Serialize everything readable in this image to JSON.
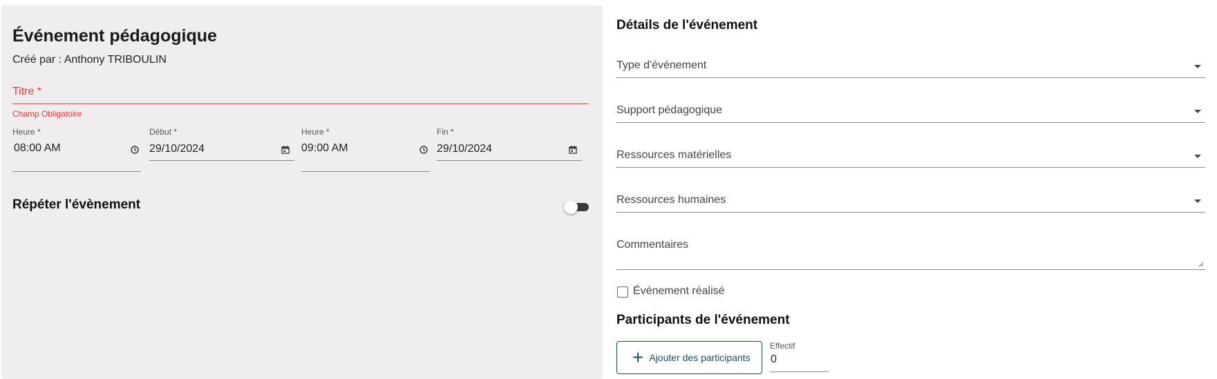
{
  "event": {
    "title": "Événement pédagogique",
    "created_by": "Créé par : Anthony TRIBOULIN",
    "titre_label": "Titre *",
    "titre_value": "",
    "titre_error": "Champ Obligatoire",
    "start_time": {
      "label": "Heure *",
      "value": "08:00 AM"
    },
    "start_date": {
      "label": "Début *",
      "value": "29/10/2024"
    },
    "end_time": {
      "label": "Heure *",
      "value": "09:00 AM"
    },
    "end_date": {
      "label": "Fin *",
      "value": "29/10/2024"
    },
    "repeat_label": "Répéter l'évènement",
    "repeat_enabled": false
  },
  "details": {
    "title": "Détails de l'événement",
    "selects": [
      {
        "label": "Type d'événement",
        "value": ""
      },
      {
        "label": "Support pédagogique",
        "value": ""
      },
      {
        "label": "Ressources matérielles",
        "value": ""
      },
      {
        "label": "Ressources humaines",
        "value": ""
      }
    ],
    "comments_label": "Commentaires",
    "completed_label": "Événement réalisé",
    "completed": false
  },
  "participants": {
    "title": "Participants de l'événement",
    "add_button_label": "Ajouter des participants",
    "effectif_label": "Effectif",
    "effectif_value": "0"
  },
  "colors": {
    "error": "#e53935",
    "panel_bg": "#efeded",
    "accent": "#1b4d5c"
  },
  "icons": [
    "clock-icon",
    "calendar-icon",
    "chevron-down-icon",
    "plus-icon",
    "resize-handle-icon"
  ]
}
